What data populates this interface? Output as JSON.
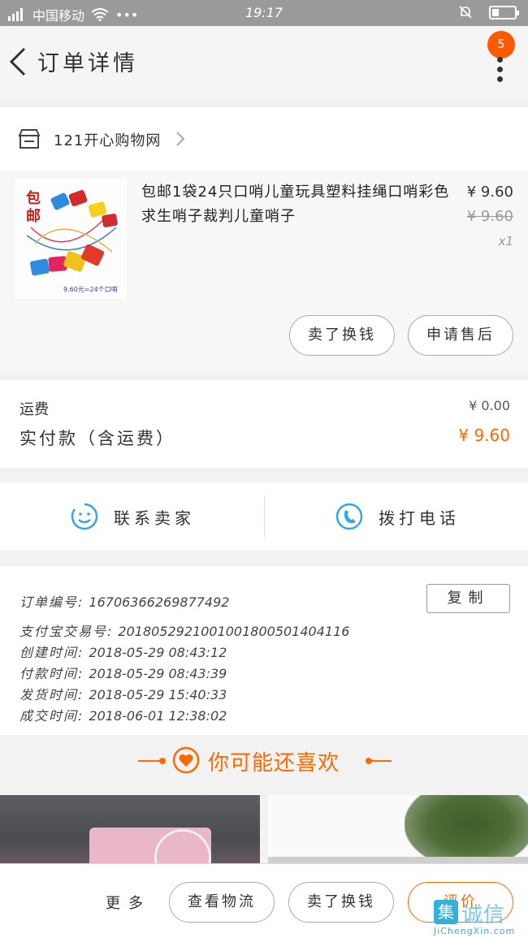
{
  "status_bar": {
    "carrier": "中国移动",
    "time": "19:17",
    "dots": "•••"
  },
  "header": {
    "title": "订单详情",
    "notification_count": "5"
  },
  "store": {
    "name": "121开心购物网"
  },
  "product": {
    "thumbnail_tag": "包邮",
    "thumbnail_caption": "9.60元=24个口哨",
    "name": "包邮1袋24只口哨儿童玩具塑料挂绳口哨彩色求生哨子裁判儿童哨子",
    "price": "¥ 9.60",
    "original_price": "¥ 9.60",
    "quantity": "x1",
    "actions": [
      "卖了换钱",
      "申请售后"
    ]
  },
  "fees": {
    "shipping_label": "运费",
    "shipping_value": "¥ 0.00",
    "paid_label": "实付款（含运费）",
    "paid_value": "¥ 9.60"
  },
  "contact": {
    "seller_label": "联系卖家",
    "call_label": "拨打电话"
  },
  "order_info": {
    "copy_label": "复制",
    "lines": [
      {
        "key": "订单编号:",
        "value": "16706366269877492"
      },
      {
        "key": "支付宝交易号:",
        "value": "2018052921001001800501404116"
      },
      {
        "key": "创建时间:",
        "value": "2018-05-29 08:43:12"
      },
      {
        "key": "付款时间:",
        "value": "2018-05-29 08:43:39"
      },
      {
        "key": "发货时间:",
        "value": "2018-05-29 15:40:33"
      },
      {
        "key": "成交时间:",
        "value": "2018-06-01 12:38:02"
      }
    ]
  },
  "recommend": {
    "title": "你可能还喜欢"
  },
  "bottom_bar": {
    "more": "更多",
    "logistics": "查看物流",
    "resell": "卖了换钱",
    "review": "评价"
  },
  "watermark": {
    "mark": "集",
    "cn": "诚信",
    "en": "JiChengXin.com"
  },
  "colors": {
    "accent": "#ff6a00",
    "contact_blue": "#35a6e6"
  }
}
